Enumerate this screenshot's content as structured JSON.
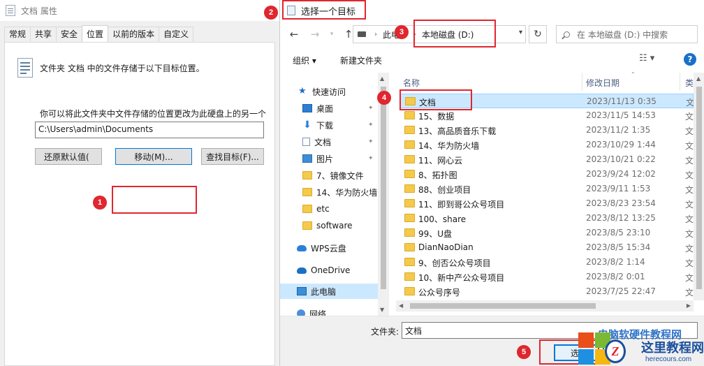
{
  "props": {
    "title": "文档 属性",
    "tabs": [
      "常规",
      "共享",
      "安全",
      "位置",
      "以前的版本",
      "自定义"
    ],
    "active_tab": "位置",
    "intro": "文件夹 文档 中的文件存储于以下目标位置。",
    "desc": "你可以将此文件夹中文件存储的位置更改为此硬盘上的另一个位置、另一个驱动器或网络上的另一台计算机。",
    "path_value": "C:\\Users\\admin\\Documents",
    "restore_label": "还原默认值(",
    "move_label": "移动(M)...",
    "find_label": "查找目标(F)..."
  },
  "picker": {
    "title": "选择一个目标",
    "breadcrumb_pc": "此电",
    "breadcrumb_drive": "本地磁盘 (D:)",
    "search_placeholder": "在 本地磁盘 (D:) 中搜索",
    "organize_label": "组织 ▾",
    "new_folder_label": "新建文件夹",
    "help_label": "?",
    "nav": {
      "quick_access": "快速访问",
      "desktop": "桌面",
      "downloads": "下载",
      "documents": "文档",
      "pictures": "图片",
      "f1": "7、镜像文件",
      "f2": "14、华为防火墙",
      "f3": "etc",
      "f4": "software",
      "wps": "WPS云盘",
      "onedrive": "OneDrive",
      "this_pc": "此电脑",
      "network": "网络"
    },
    "columns": {
      "name": "名称",
      "date": "修改日期",
      "type": "类"
    },
    "files": [
      {
        "name": "文档",
        "date": "2023/11/13 0:35",
        "type": "文"
      },
      {
        "name": "15、数据",
        "date": "2023/11/5 14:53",
        "type": "文"
      },
      {
        "name": "13、高品质音乐下载",
        "date": "2023/11/2 1:35",
        "type": "文"
      },
      {
        "name": "14、华为防火墙",
        "date": "2023/10/29 1:44",
        "type": "文"
      },
      {
        "name": "11、网心云",
        "date": "2023/10/21 0:22",
        "type": "文"
      },
      {
        "name": "8、拓扑图",
        "date": "2023/9/24 12:02",
        "type": "文"
      },
      {
        "name": "88、创业项目",
        "date": "2023/9/11 1:53",
        "type": "文"
      },
      {
        "name": "11、即到哥公众号项目",
        "date": "2023/8/23 23:54",
        "type": "文"
      },
      {
        "name": "100、share",
        "date": "2023/8/12 13:25",
        "type": "文"
      },
      {
        "name": "99、U盘",
        "date": "2023/8/5 23:10",
        "type": "文"
      },
      {
        "name": "DianNaoDian",
        "date": "2023/8/5 15:34",
        "type": "文"
      },
      {
        "name": "9、创否公众号项目",
        "date": "2023/8/2 1:14",
        "type": "文"
      },
      {
        "name": "10、新中产公众号项目",
        "date": "2023/8/2 0:01",
        "type": "文"
      },
      {
        "name": "公众号序号",
        "date": "2023/7/25 22:47",
        "type": "文"
      }
    ],
    "folder_label": "文件夹:",
    "folder_value": "文档",
    "ok_label": "选择"
  },
  "badges": [
    "1",
    "2",
    "3",
    "4",
    "5"
  ],
  "watermark": {
    "top": "电脑软硬件教程网",
    "cn": "这里教程网",
    "url": "herecours.com"
  },
  "colors": {
    "annotation": "#e0262e",
    "selection": "#cce8ff",
    "accent": "#0078d7"
  }
}
